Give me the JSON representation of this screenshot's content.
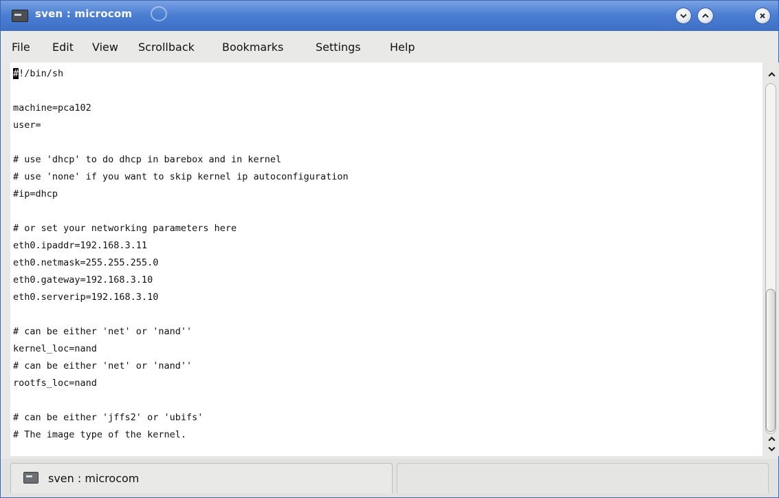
{
  "window": {
    "title": "sven : microcom"
  },
  "menu": [
    "File",
    "Edit",
    "View",
    "Scrollback",
    "Bookmarks",
    "Settings",
    "Help"
  ],
  "terminal": {
    "cursor_char": "#",
    "lines": [
      "!/bin/sh",
      "",
      "machine=pca102",
      "user=",
      "",
      "# use 'dhcp' to do dhcp in barebox and in kernel",
      "# use 'none' if you want to skip kernel ip autoconfiguration",
      "#ip=dhcp",
      "",
      "# or set your networking parameters here",
      "eth0.ipaddr=192.168.3.11",
      "eth0.netmask=255.255.255.0",
      "eth0.gateway=192.168.3.10",
      "eth0.serverip=192.168.3.10",
      "",
      "# can be either 'net' or 'nand''",
      "kernel_loc=nand",
      "# can be either 'net' or 'nand''",
      "rootfs_loc=nand",
      "",
      "# can be either 'jffs2' or 'ubifs'",
      "# The image type of the kernel."
    ]
  },
  "tabs": [
    {
      "label": "sven : microcom"
    }
  ],
  "icons": {
    "app": "terminal-icon",
    "minimize": "chevron-down-icon",
    "maximize": "chevron-up-icon",
    "close": "close-icon",
    "tab": "terminal-icon"
  },
  "colors": {
    "titlebar": "#4c7fd3",
    "terminal_bg": "#ffffff",
    "text": "#111111"
  }
}
